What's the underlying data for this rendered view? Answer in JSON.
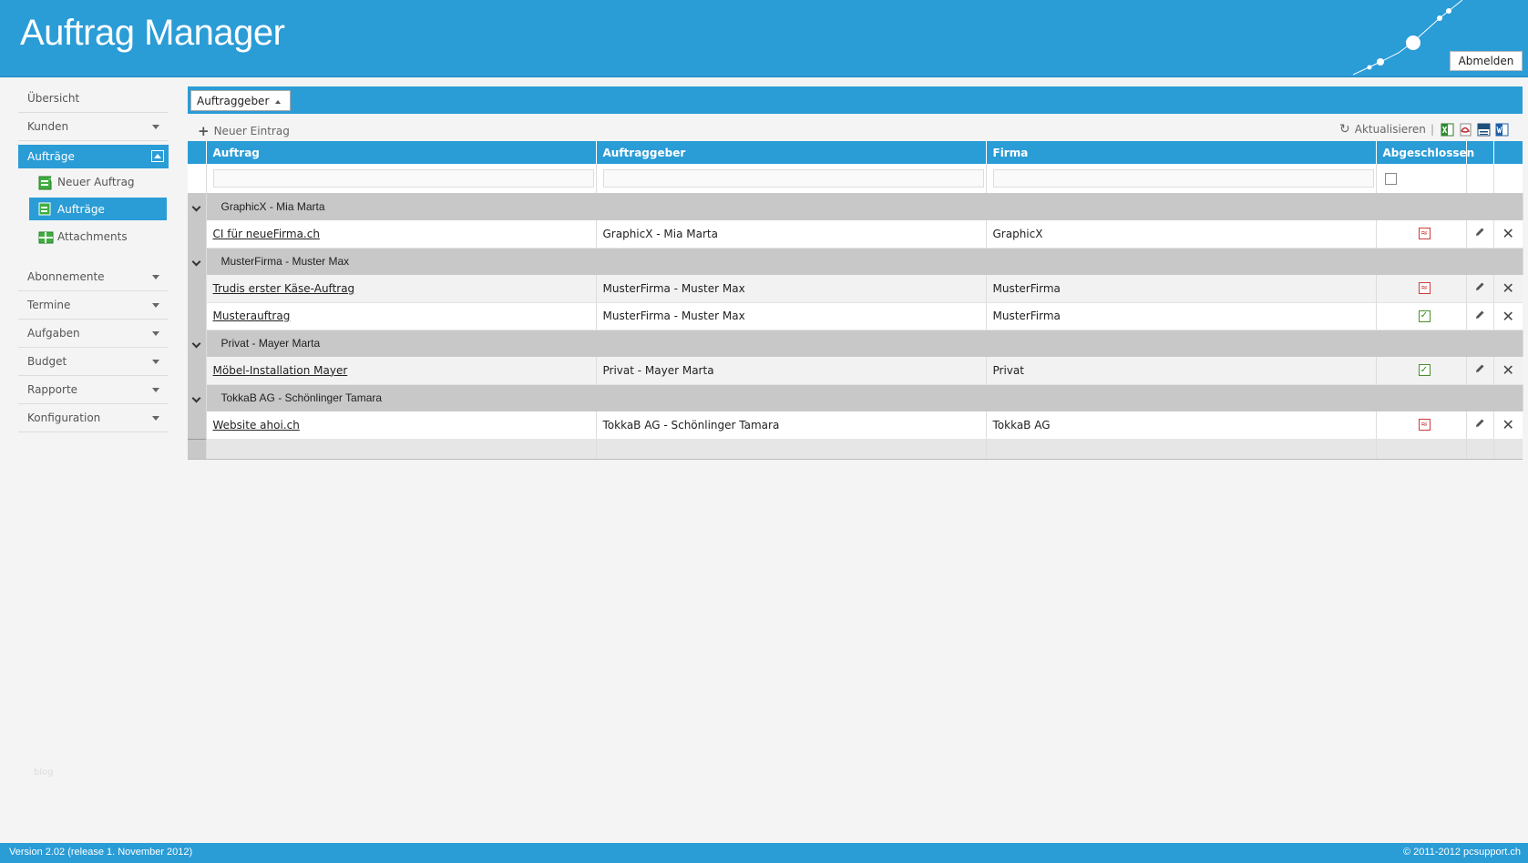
{
  "app": {
    "title": "Auftrag Manager",
    "logout_label": "Abmelden"
  },
  "sidebar": {
    "items": [
      {
        "label": "Übersicht"
      },
      {
        "label": "Kunden"
      },
      {
        "label": "Aufträge"
      },
      {
        "label": "Abonnemente"
      },
      {
        "label": "Termine"
      },
      {
        "label": "Aufgaben"
      },
      {
        "label": "Budget"
      },
      {
        "label": "Rapporte"
      },
      {
        "label": "Konfiguration"
      }
    ],
    "sub_items": [
      {
        "label": "Neuer Auftrag"
      },
      {
        "label": "Aufträge"
      },
      {
        "label": "Attachments"
      }
    ]
  },
  "grid": {
    "group_chip": "Auftraggeber",
    "new_entry": "Neuer Eintrag",
    "refresh": "Aktualisieren",
    "separator": "|",
    "columns": [
      "Auftrag",
      "Auftraggeber",
      "Firma",
      "Abgeschlossen"
    ],
    "groups": [
      {
        "title": "GraphicX - Mia Marta",
        "rows": [
          {
            "auftrag": "CI für neueFirma.ch",
            "auftraggeber": "GraphicX - Mia Marta",
            "firma": "GraphicX",
            "abgeschlossen": false
          }
        ]
      },
      {
        "title": "MusterFirma - Muster Max",
        "rows": [
          {
            "auftrag": "Trudis erster Käse-Auftrag",
            "auftraggeber": "MusterFirma - Muster Max",
            "firma": "MusterFirma",
            "abgeschlossen": false
          },
          {
            "auftrag": "Musterauftrag",
            "auftraggeber": "MusterFirma - Muster Max",
            "firma": "MusterFirma",
            "abgeschlossen": true
          }
        ]
      },
      {
        "title": "Privat - Mayer Marta",
        "rows": [
          {
            "auftrag": "Möbel-Installation Mayer",
            "auftraggeber": "Privat - Mayer Marta",
            "firma": "Privat",
            "abgeschlossen": true
          }
        ]
      },
      {
        "title": "TokkaB AG - Schönlinger Tamara",
        "rows": [
          {
            "auftrag": "Website ahoi.ch",
            "auftraggeber": "TokkaB AG - Schönlinger Tamara",
            "firma": "TokkaB AG",
            "abgeschlossen": false
          }
        ]
      }
    ]
  },
  "footer": {
    "version": "Version 2.02 (release 1. November 2012)",
    "copyright": "© 2011-2012 pcsupport.ch",
    "blog": "blog"
  },
  "colors": {
    "accent": "#2a9cd6",
    "group_bg": "#c8c8c8"
  },
  "icons": {
    "export": [
      "excel-export-icon",
      "pdf-export-icon",
      "csv-export-icon",
      "word-export-icon"
    ],
    "row_actions": [
      "edit-pencil-icon",
      "delete-x-icon"
    ]
  }
}
